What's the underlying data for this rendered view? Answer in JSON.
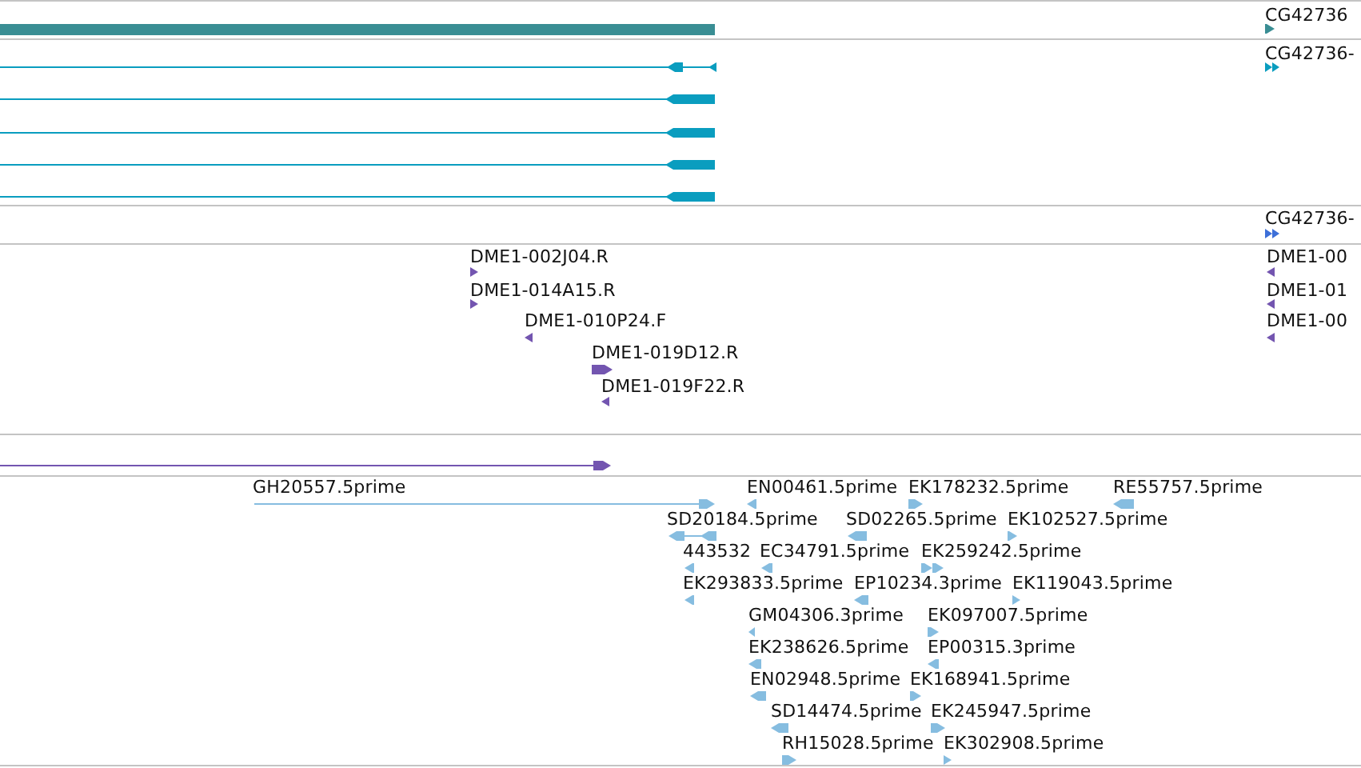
{
  "tracks": [
    {
      "color": "#3a8e94",
      "features": [
        {
          "kind": "bar"
        },
        {
          "label": "CG42736",
          "kind": "arrow",
          "reverse": false
        }
      ]
    },
    {
      "color": "#0a9dbf",
      "features": [
        {
          "kind": "arrow",
          "reverse": true
        },
        {
          "kind": "arrow",
          "reverse": true
        },
        {
          "kind": "arrow",
          "reverse": true
        },
        {
          "kind": "arrow",
          "reverse": true
        },
        {
          "kind": "arrow",
          "reverse": true
        },
        {
          "label": "CG42736-",
          "kind": "double-arrow",
          "reverse": false
        }
      ]
    },
    {
      "color": "#3d6fd8",
      "features": [
        {
          "label": "CG42736-",
          "kind": "double-arrow",
          "reverse": false
        }
      ]
    },
    {
      "color": "#7355b0",
      "features": [
        {
          "label": "DME1-002J04.R",
          "kind": "arrow",
          "reverse": false
        },
        {
          "label": "DME1-014A15.R",
          "kind": "arrow",
          "reverse": false
        },
        {
          "label": "DME1-010P24.F",
          "kind": "arrow",
          "reverse": true
        },
        {
          "label": "DME1-019D12.R",
          "kind": "arrow",
          "reverse": false
        },
        {
          "label": "DME1-019F22.R",
          "kind": "arrow",
          "reverse": true
        },
        {
          "label": "DME1-00",
          "kind": "arrow",
          "reverse": true
        },
        {
          "label": "DME1-01",
          "kind": "arrow",
          "reverse": true
        },
        {
          "label": "DME1-00",
          "kind": "arrow",
          "reverse": true
        }
      ]
    },
    {
      "color": "#7355b0",
      "features": [
        {
          "kind": "arrow",
          "reverse": false
        }
      ]
    },
    {
      "color": "#86bde0",
      "features": [
        {
          "label": "GH20557.5prime",
          "kind": "arrow",
          "reverse": false
        },
        {
          "label": "EN00461.5prime",
          "kind": "arrow",
          "reverse": true
        },
        {
          "label": "EK178232.5prime",
          "kind": "arrow",
          "reverse": false
        },
        {
          "label": "RE55757.5prime",
          "kind": "arrow",
          "reverse": true
        },
        {
          "label": "SD20184.5prime",
          "kind": "arrow",
          "reverse": true
        },
        {
          "label": "SD02265.5prime",
          "kind": "arrow",
          "reverse": true
        },
        {
          "label": "EK102527.5prime",
          "kind": "arrow",
          "reverse": false
        },
        {
          "label": "443532",
          "kind": "arrow",
          "reverse": true
        },
        {
          "label": "EC34791.5prime",
          "kind": "arrow",
          "reverse": true
        },
        {
          "label": "EK259242.5prime",
          "kind": "double-arrow",
          "reverse": false
        },
        {
          "label": "EK293833.5prime",
          "kind": "arrow",
          "reverse": true
        },
        {
          "label": "EP10234.3prime",
          "kind": "arrow",
          "reverse": true
        },
        {
          "label": "EK119043.5prime",
          "kind": "arrow",
          "reverse": false
        },
        {
          "label": "GM04306.3prime",
          "kind": "arrow",
          "reverse": true
        },
        {
          "label": "EK097007.5prime",
          "kind": "arrow",
          "reverse": false
        },
        {
          "label": "EK238626.5prime",
          "kind": "arrow",
          "reverse": true
        },
        {
          "label": "EP00315.3prime",
          "kind": "arrow",
          "reverse": true
        },
        {
          "label": "EN02948.5prime",
          "kind": "arrow",
          "reverse": true
        },
        {
          "label": "EK168941.5prime",
          "kind": "arrow",
          "reverse": false
        },
        {
          "label": "SD14474.5prime",
          "kind": "arrow",
          "reverse": true
        },
        {
          "label": "EK245947.5prime",
          "kind": "arrow",
          "reverse": false
        },
        {
          "label": "RH15028.5prime",
          "kind": "arrow",
          "reverse": false
        },
        {
          "label": "EK302908.5prime",
          "kind": "arrow",
          "reverse": false
        }
      ]
    }
  ]
}
